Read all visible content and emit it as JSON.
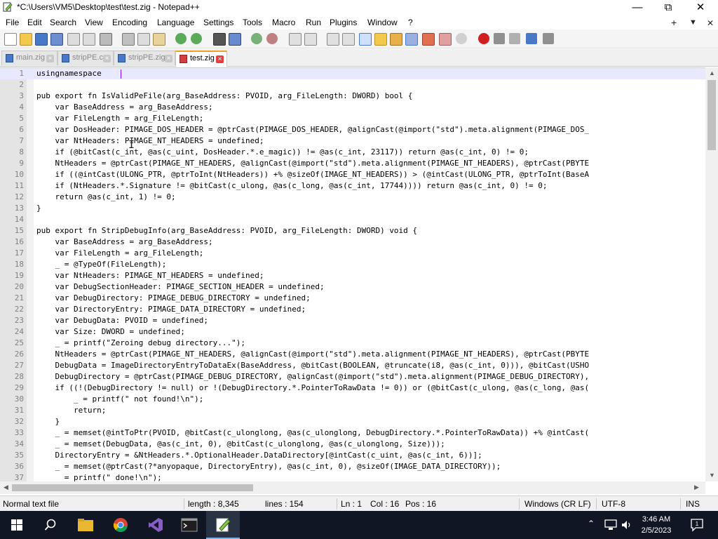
{
  "window": {
    "title": "*C:\\Users\\VM5\\Desktop\\test\\test.zig - Notepad++",
    "minimize_icon": "minimize-icon",
    "maximize_icon": "restore-icon",
    "close_icon": "close-icon"
  },
  "menu": {
    "items": [
      "File",
      "Edit",
      "Search",
      "View",
      "Encoding",
      "Language",
      "Settings",
      "Tools",
      "Macro",
      "Run",
      "Plugins",
      "Window",
      "?"
    ],
    "right": [
      "+",
      "▼",
      "✕"
    ]
  },
  "tabs": [
    {
      "label": "main.zig",
      "active": false
    },
    {
      "label": "stripPE.c",
      "active": false
    },
    {
      "label": "stripPE.zig",
      "active": false
    },
    {
      "label": "test.zig",
      "active": true
    }
  ],
  "editor": {
    "lines": [
      {
        "n": "1",
        "text": "usingnamespace "
      },
      {
        "n": "2",
        "text": ""
      },
      {
        "n": "3",
        "text": "pub export fn IsValidPeFile(arg_BaseAddress: PVOID, arg_FileLength: DWORD) bool {"
      },
      {
        "n": "4",
        "text": "    var BaseAddress = arg_BaseAddress;"
      },
      {
        "n": "5",
        "text": "    var FileLength = arg_FileLength;"
      },
      {
        "n": "6",
        "text": "    var DosHeader: PIMAGE_DOS_HEADER = @ptrCast(PIMAGE_DOS_HEADER, @alignCast(@import(\"std\").meta.alignment(PIMAGE_DOS_"
      },
      {
        "n": "7",
        "text": "    var NtHeaders: PIMAGE_NT_HEADERS = undefined;"
      },
      {
        "n": "8",
        "text": "    if (@bitCast(c_int, @as(c_uint, DosHeader.*.e_magic)) != @as(c_int, 23117)) return @as(c_int, 0) != 0;"
      },
      {
        "n": "9",
        "text": "    NtHeaders = @ptrCast(PIMAGE_NT_HEADERS, @alignCast(@import(\"std\").meta.alignment(PIMAGE_NT_HEADERS), @ptrCast(PBYTE"
      },
      {
        "n": "10",
        "text": "    if ((@intCast(ULONG_PTR, @ptrToInt(NtHeaders)) +% @sizeOf(IMAGE_NT_HEADERS)) > (@intCast(ULONG_PTR, @ptrToInt(BaseA"
      },
      {
        "n": "11",
        "text": "    if (NtHeaders.*.Signature != @bitCast(c_ulong, @as(c_long, @as(c_int, 17744)))) return @as(c_int, 0) != 0;"
      },
      {
        "n": "12",
        "text": "    return @as(c_int, 1) != 0;"
      },
      {
        "n": "13",
        "text": "}"
      },
      {
        "n": "14",
        "text": ""
      },
      {
        "n": "15",
        "text": "pub export fn StripDebugInfo(arg_BaseAddress: PVOID, arg_FileLength: DWORD) void {"
      },
      {
        "n": "16",
        "text": "    var BaseAddress = arg_BaseAddress;"
      },
      {
        "n": "17",
        "text": "    var FileLength = arg_FileLength;"
      },
      {
        "n": "18",
        "text": "    _ = @TypeOf(FileLength);"
      },
      {
        "n": "19",
        "text": "    var NtHeaders: PIMAGE_NT_HEADERS = undefined;"
      },
      {
        "n": "20",
        "text": "    var DebugSectionHeader: PIMAGE_SECTION_HEADER = undefined;"
      },
      {
        "n": "21",
        "text": "    var DebugDirectory: PIMAGE_DEBUG_DIRECTORY = undefined;"
      },
      {
        "n": "22",
        "text": "    var DirectoryEntry: PIMAGE_DATA_DIRECTORY = undefined;"
      },
      {
        "n": "23",
        "text": "    var DebugData: PVOID = undefined;"
      },
      {
        "n": "24",
        "text": "    var Size: DWORD = undefined;"
      },
      {
        "n": "25",
        "text": "    _ = printf(\"Zeroing debug directory...\");"
      },
      {
        "n": "26",
        "text": "    NtHeaders = @ptrCast(PIMAGE_NT_HEADERS, @alignCast(@import(\"std\").meta.alignment(PIMAGE_NT_HEADERS), @ptrCast(PBYTE"
      },
      {
        "n": "27",
        "text": "    DebugData = ImageDirectoryEntryToDataEx(BaseAddress, @bitCast(BOOLEAN, @truncate(i8, @as(c_int, 0))), @bitCast(USHO"
      },
      {
        "n": "28",
        "text": "    DebugDirectory = @ptrCast(PIMAGE_DEBUG_DIRECTORY, @alignCast(@import(\"std\").meta.alignment(PIMAGE_DEBUG_DIRECTORY),"
      },
      {
        "n": "29",
        "text": "    if ((!(DebugDirectory != null) or !(DebugDirectory.*.PointerToRawData != 0)) or (@bitCast(c_ulong, @as(c_long, @as("
      },
      {
        "n": "30",
        "text": "        _ = printf(\" not found!\\n\");"
      },
      {
        "n": "31",
        "text": "        return;"
      },
      {
        "n": "32",
        "text": "    }"
      },
      {
        "n": "33",
        "text": "    _ = memset(@intToPtr(PVOID, @bitCast(c_ulonglong, @as(c_ulonglong, DebugDirectory.*.PointerToRawData)) +% @intCast("
      },
      {
        "n": "34",
        "text": "    _ = memset(DebugData, @as(c_int, 0), @bitCast(c_ulonglong, @as(c_ulonglong, Size)));"
      },
      {
        "n": "35",
        "text": "    DirectoryEntry = &NtHeaders.*.OptionalHeader.DataDirectory[@intCast(c_uint, @as(c_int, 6))];"
      },
      {
        "n": "36",
        "text": "    _ = memset(@ptrCast(?*anyopaque, DirectoryEntry), @as(c_int, 0), @sizeOf(IMAGE_DATA_DIRECTORY));"
      },
      {
        "n": "37",
        "text": "    _ = printf(\" done!\\n\");"
      }
    ]
  },
  "status": {
    "file_type": "Normal text file",
    "length": "length : 8,345",
    "lines": "lines : 154",
    "ln": "Ln : 1",
    "col": "Col : 16",
    "pos": "Pos : 16",
    "eol": "Windows (CR LF)",
    "encoding": "UTF-8",
    "mode": "INS"
  },
  "taskbar": {
    "apps": [
      "windows-start-icon",
      "search-icon",
      "file-explorer-icon",
      "chrome-icon",
      "visual-studio-icon",
      "terminal-icon",
      "notepad-plus-plus-icon"
    ],
    "time": "3:46 AM",
    "date": "2/5/2023"
  }
}
